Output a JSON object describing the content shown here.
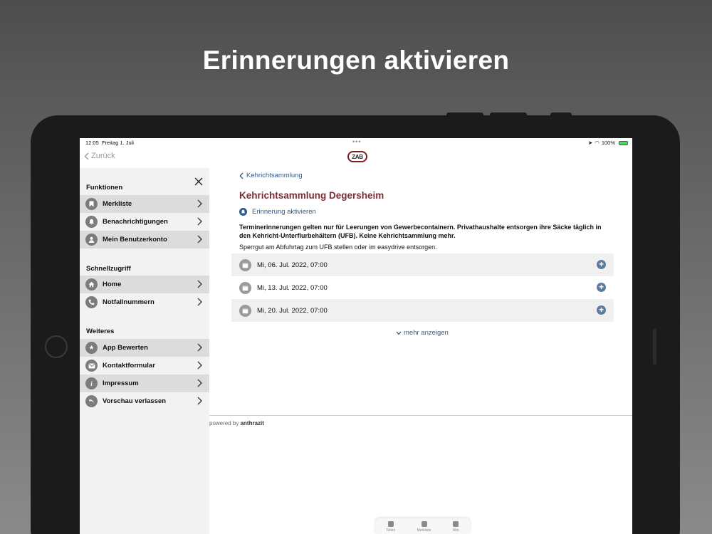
{
  "headline": "Erinnerungen aktivieren",
  "status_bar": {
    "time": "12:05",
    "date": "Freitag 1. Juli",
    "dots": "•••",
    "battery": "100%"
  },
  "nav": {
    "back_label": "Zurück",
    "logo_text": "ZAB"
  },
  "sidebar": {
    "sections": [
      {
        "title": "Funktionen",
        "items": [
          {
            "label": "Merkliste",
            "icon": "bookmark-icon"
          },
          {
            "label": "Benachrichtigungen",
            "icon": "bell-icon"
          },
          {
            "label": "Mein Benutzerkonto",
            "icon": "user-icon"
          }
        ]
      },
      {
        "title": "Schnellzugriff",
        "items": [
          {
            "label": "Home",
            "icon": "home-icon"
          },
          {
            "label": "Notfallnummern",
            "icon": "phone-icon"
          }
        ]
      },
      {
        "title": "Weiteres",
        "items": [
          {
            "label": "App Bewerten",
            "icon": "star-icon"
          },
          {
            "label": "Kontaktformular",
            "icon": "mail-icon"
          },
          {
            "label": "Impressum",
            "icon": "info-icon"
          },
          {
            "label": "Vorschau verlassen",
            "icon": "undo-icon"
          }
        ]
      }
    ]
  },
  "content": {
    "breadcrumb": "Kehrichtsammlung",
    "title": "Kehrichtsammlung Degersheim",
    "reminder_link": "Erinnerung aktivieren",
    "notice_bold": "Terminerinnerungen gelten nur für Leerungen von Gewerbecontainern. Privathaushalte entsorgen ihre Säcke täglich in den Kehricht-Unterflurbehältern (UFB). Keine Kehrichtsammlung mehr.",
    "notice": "Sperrgut am Abfuhrtag zum UFB stellen oder im easydrive entsorgen.",
    "dates": [
      "Mi, 06. Jul. 2022, 07:00",
      "Mi, 13. Jul. 2022, 07:00",
      "Mi, 20. Jul. 2022, 07:00"
    ],
    "more_label": "mehr anzeigen"
  },
  "footer": {
    "powered_prefix": "powered by",
    "powered_brand": "anthrazit"
  },
  "tabbar": {
    "items": [
      "Teilen",
      "Merkliste",
      "Abo"
    ]
  },
  "colors": {
    "title_red": "#7a2e33",
    "link_blue": "#2d5a8c",
    "plus_blue": "#5d7c9b"
  }
}
